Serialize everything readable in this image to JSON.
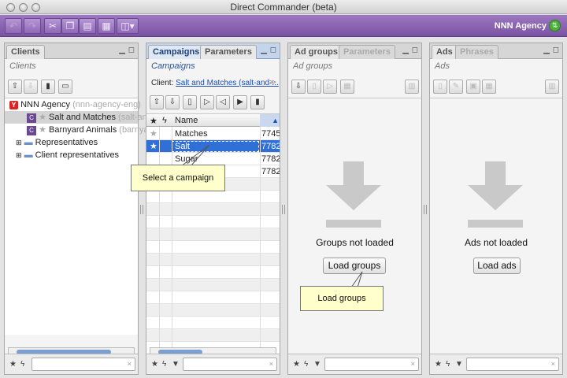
{
  "window": {
    "title": "Direct Commander (beta)"
  },
  "toolbar": {
    "agency": "NNN Agency",
    "buttons": [
      {
        "name": "undo-icon",
        "glyph": "↶"
      },
      {
        "name": "redo-icon",
        "glyph": "↷"
      },
      {
        "name": "cut-icon",
        "glyph": "✂"
      },
      {
        "name": "copy-icon",
        "glyph": "❐"
      },
      {
        "name": "paste-icon",
        "glyph": "▤"
      },
      {
        "name": "table-icon",
        "glyph": "▦"
      },
      {
        "name": "view-menu-icon",
        "glyph": "◫▾"
      }
    ]
  },
  "clients": {
    "tab": "Clients",
    "subtitle": "Clients",
    "agency_label": "NNN Agency",
    "agency_login": "(nnn-agency-eng)",
    "items": [
      {
        "name": "Salt and Matches",
        "login": "(salt-and-"
      },
      {
        "name": "Barnyard Animals",
        "login": "(barnyar"
      }
    ],
    "groups": [
      "Representatives",
      "Client representatives"
    ]
  },
  "campaigns": {
    "tabs": [
      "Campaigns",
      "Parameters"
    ],
    "subtitle": "Campaigns",
    "client_label": "Client:",
    "client_link": "Salt and Matches (salt-and-...",
    "col_name": "Name",
    "rows": [
      {
        "name": "Matches",
        "id": "7745"
      },
      {
        "name": "Salt",
        "id": "7782"
      },
      {
        "name": "Sugar",
        "id": "7782"
      },
      {
        "name": "",
        "id": "7782"
      }
    ],
    "tooltip": "Select a campaign"
  },
  "adgroups": {
    "tabs": [
      "Ad groups",
      "Parameters"
    ],
    "subtitle": "Ad groups",
    "empty_text": "Groups not loaded",
    "load_button": "Load groups",
    "tooltip": "Load groups"
  },
  "ads": {
    "tabs": [
      "Ads",
      "Phrases"
    ],
    "subtitle": "Ads",
    "empty_text": "Ads not loaded",
    "load_button": "Load ads"
  },
  "footer": {
    "search_clear": "×"
  }
}
